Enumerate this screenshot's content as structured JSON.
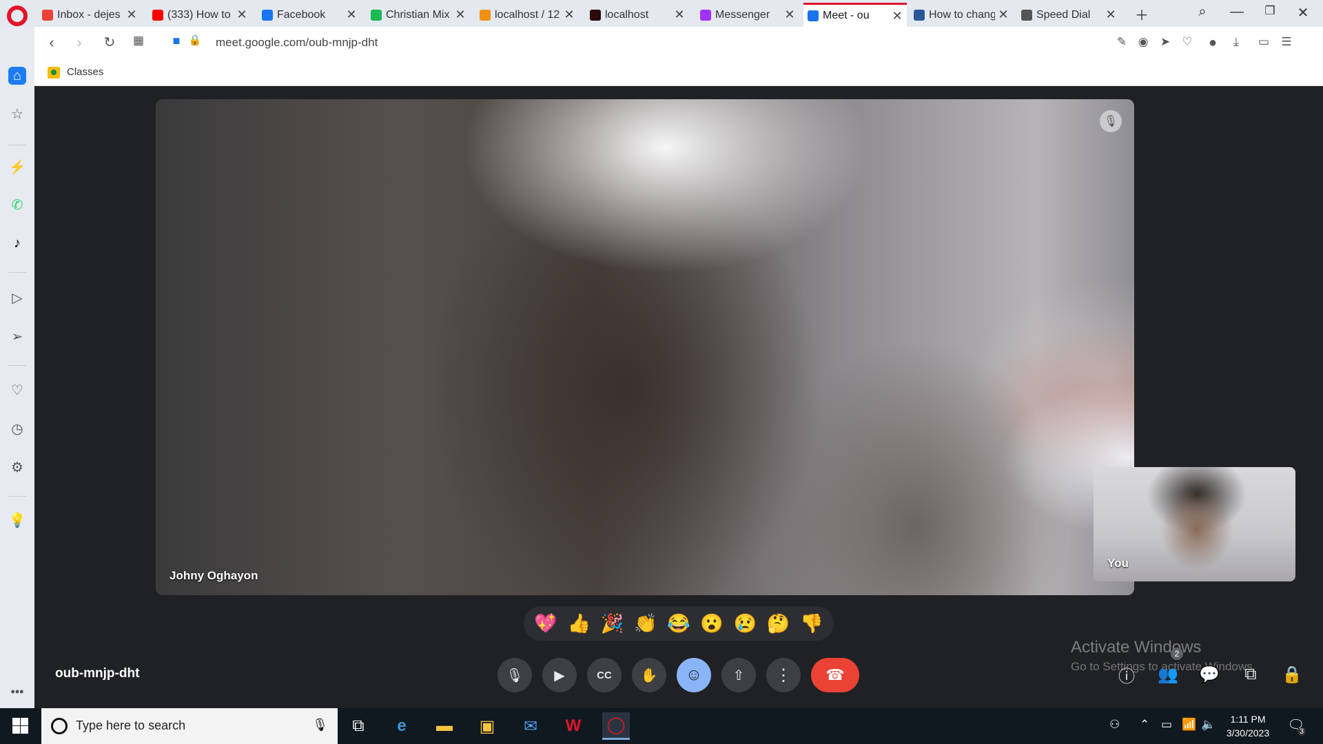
{
  "browser": {
    "tabs": [
      {
        "label": "Inbox - dejes",
        "icon": "gmail-icon",
        "color": "#ea4335",
        "active": false
      },
      {
        "label": "(333) How to",
        "icon": "youtube-icon",
        "color": "#ff0000",
        "active": false
      },
      {
        "label": "Facebook",
        "icon": "facebook-icon",
        "color": "#1877f2",
        "active": false
      },
      {
        "label": "Christian Mix",
        "icon": "spotify-icon",
        "color": "#1db954",
        "active": false
      },
      {
        "label": "localhost / 12",
        "icon": "phpmyadmin-icon",
        "color": "#f29111",
        "active": false
      },
      {
        "label": "localhost",
        "icon": "laravel-icon",
        "color": "#2b0a0a",
        "active": false
      },
      {
        "label": "Messenger",
        "icon": "messenger-icon",
        "color": "#a033ff",
        "active": false
      },
      {
        "label": "Meet - ou",
        "icon": "meet-icon",
        "color": "#1a73e8",
        "active": true
      },
      {
        "label": "How to chang",
        "icon": "word-icon",
        "color": "#2b579a",
        "active": false
      },
      {
        "label": "Speed Dial",
        "icon": "speed-dial-icon",
        "color": "#555555",
        "active": false
      }
    ],
    "url": "meet.google.com/oub-mnjp-dht",
    "bookmark": "Classes"
  },
  "meet": {
    "main_participant": "Johny Oghayon",
    "self_label": "You",
    "meeting_code": "oub-mnjp-dht",
    "reactions": [
      "💖",
      "👍",
      "🎉",
      "👏",
      "😂",
      "😮",
      "😢",
      "🤔",
      "👎"
    ],
    "people_count": "2",
    "accent": "#8ab4f8",
    "end_color": "#ea4335"
  },
  "watermark": {
    "line1": "Activate Windows",
    "line2": "Go to Settings to activate Windows."
  },
  "taskbar": {
    "search_placeholder": "Type here to search",
    "time": "1:11 PM",
    "date": "3/30/2023",
    "notifications": "3"
  }
}
